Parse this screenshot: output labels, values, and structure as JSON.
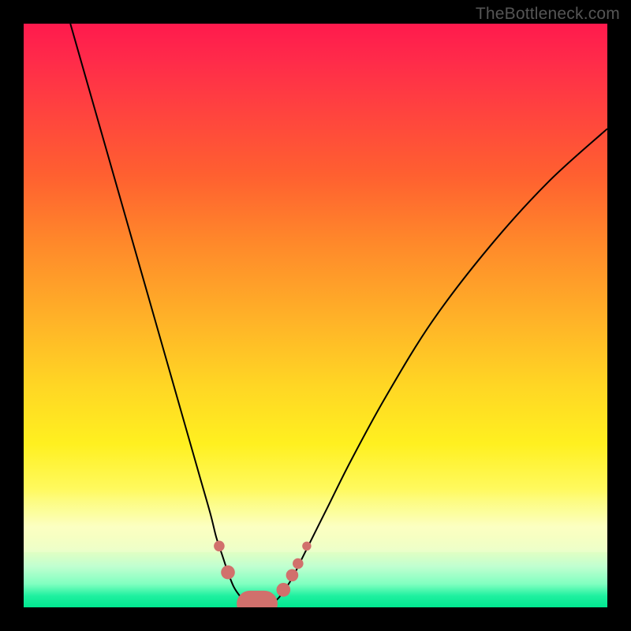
{
  "watermark": "TheBottleneck.com",
  "chart_data": {
    "type": "line",
    "title": "",
    "xlabel": "",
    "ylabel": "",
    "xlim": [
      0,
      100
    ],
    "ylim": [
      0,
      100
    ],
    "grid": false,
    "legend": false,
    "background_gradient": {
      "top": "#ff1a4d",
      "upper_mid": "#ff8a2a",
      "mid": "#fff020",
      "lower_mid": "#f8ffA0",
      "bottom": "#00e890"
    },
    "series": [
      {
        "name": "bottleneck-curve",
        "x": [
          8,
          12,
          16,
          20,
          24,
          26,
          28,
          30,
          32,
          33,
          34,
          35,
          36,
          37,
          38,
          39,
          40,
          41,
          42,
          43,
          44,
          46,
          48,
          52,
          56,
          62,
          70,
          80,
          90,
          100
        ],
        "y": [
          100,
          86,
          72,
          58,
          44,
          37,
          30,
          23,
          16,
          12,
          9,
          6,
          3.5,
          2,
          1,
          0.5,
          0,
          0,
          0.5,
          1,
          2,
          5,
          9,
          17,
          25,
          36,
          49,
          62,
          73,
          82
        ],
        "color": "#000000"
      }
    ],
    "highlight_points": {
      "comment": "points/bars near the minimum shown in salmon",
      "color": "#d1706c",
      "dots": [
        {
          "x": 33.5,
          "y": 10.5,
          "r": 1.3
        },
        {
          "x": 35.0,
          "y": 6.0,
          "r": 1.7
        },
        {
          "x": 44.5,
          "y": 3.0,
          "r": 1.7
        },
        {
          "x": 46.0,
          "y": 5.5,
          "r": 1.5
        },
        {
          "x": 47.0,
          "y": 7.5,
          "r": 1.3
        },
        {
          "x": 48.5,
          "y": 10.5,
          "r": 1.1
        }
      ],
      "flat_bar": {
        "x_start": 36.5,
        "x_end": 43.5,
        "y": 0.6,
        "thickness": 2.6
      }
    }
  }
}
